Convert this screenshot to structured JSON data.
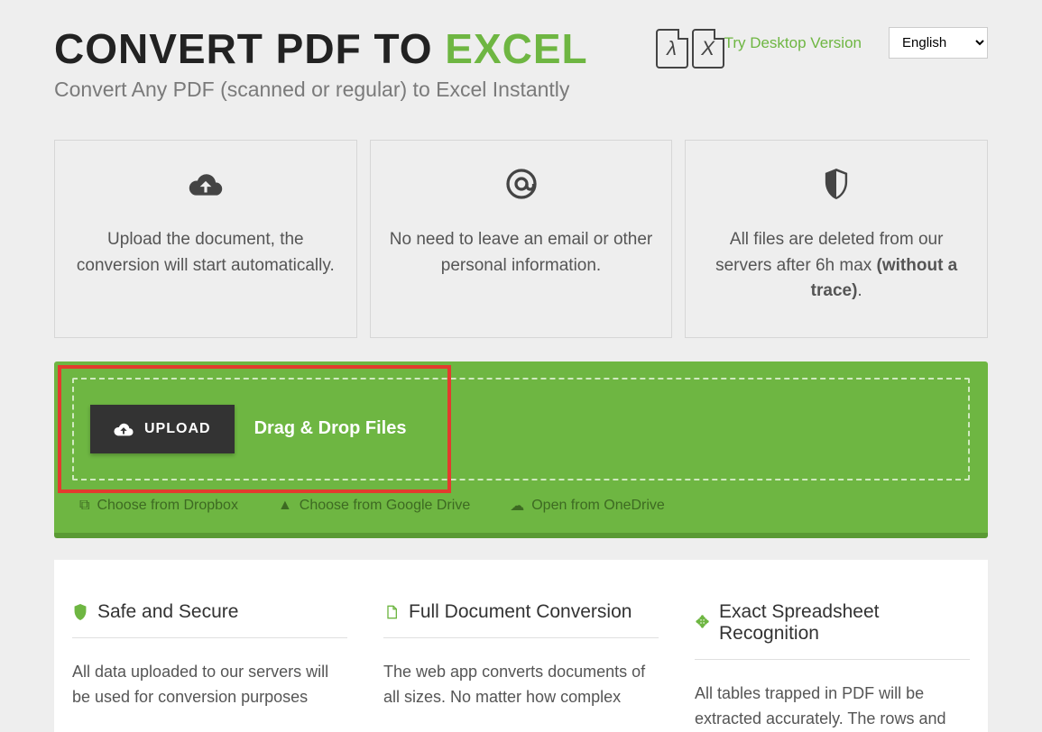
{
  "header": {
    "title_a": "CONVERT PDF TO ",
    "title_b": "EXCEL",
    "subtitle": "Convert Any PDF (scanned or regular) to Excel Instantly",
    "pdf_glyph": "λ",
    "xls_glyph": "X",
    "try_desktop": "Try Desktop Version",
    "language": "English"
  },
  "cards": [
    {
      "icon": "cloud-upload",
      "text": "Upload the document, the conversion will start automatically."
    },
    {
      "icon": "at",
      "text": "No need to leave an email or other personal information."
    },
    {
      "icon": "shield",
      "text_a": "All files are deleted from our servers after 6h max ",
      "text_b": "(without a trace)",
      "text_c": "."
    }
  ],
  "upload": {
    "button": "UPLOAD",
    "drag": "Drag & Drop Files",
    "links": [
      {
        "icon": "dropbox",
        "label": "Choose from Dropbox"
      },
      {
        "icon": "gdrive",
        "label": "Choose from Google Drive"
      },
      {
        "icon": "onedrive",
        "label": "Open from OneDrive"
      }
    ]
  },
  "features": [
    {
      "icon": "shield",
      "title": "Safe and Secure",
      "body": "All data uploaded to our servers will be used for conversion purposes"
    },
    {
      "icon": "document",
      "title": "Full Document Conversion",
      "body": "The web app converts documents of all sizes. No matter how complex"
    },
    {
      "icon": "crosshair",
      "title": "Exact Spreadsheet Recognition",
      "body": "All tables trapped in PDF will be extracted accurately. The rows and"
    }
  ]
}
